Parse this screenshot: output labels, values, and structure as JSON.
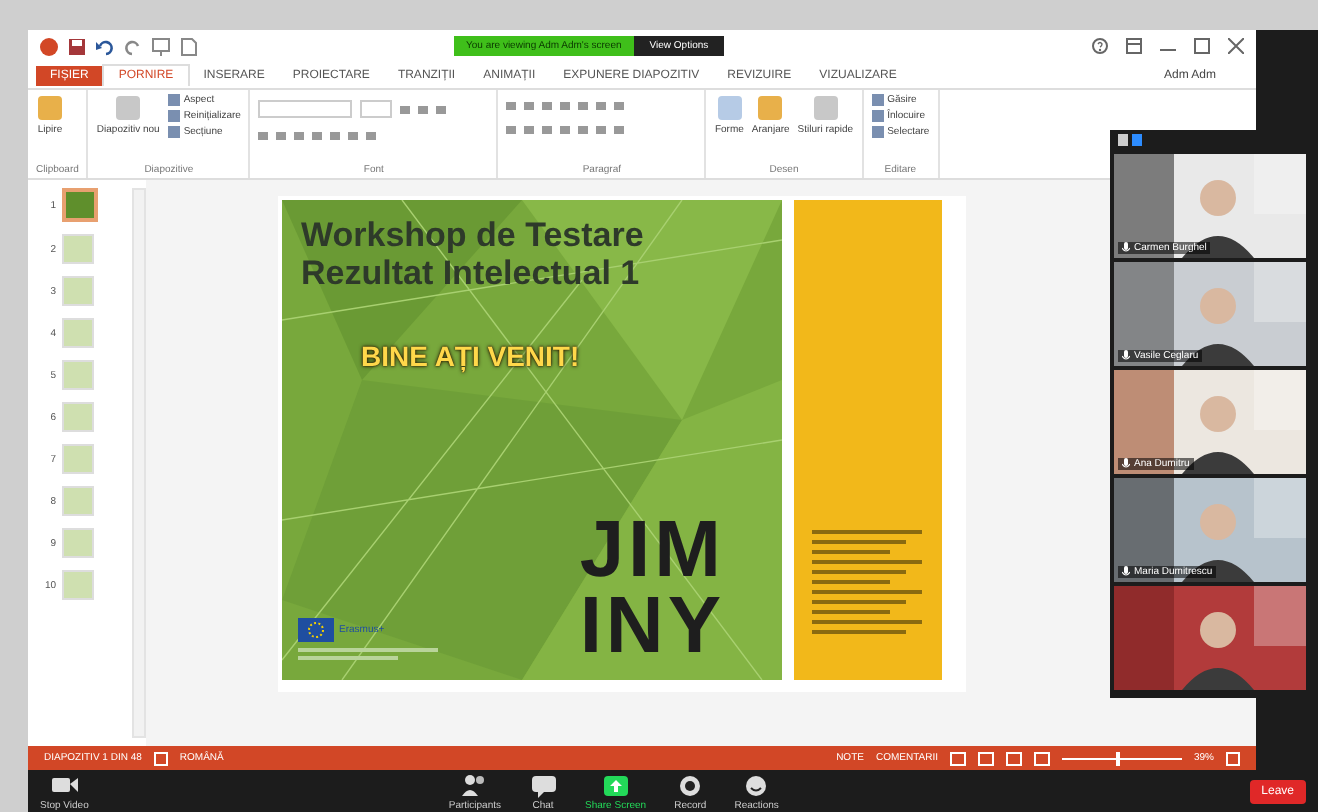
{
  "title_bar": {
    "banner": "You are viewing Adm Adm's screen",
    "view_options": "View Options",
    "account": "Adm Adm"
  },
  "ribbon_tabs": [
    {
      "label": "FIȘIER",
      "kind": "file",
      "selected": false
    },
    {
      "label": "PORNIRE",
      "kind": "tab",
      "selected": true
    },
    {
      "label": "INSERARE",
      "kind": "tab",
      "selected": false
    },
    {
      "label": "PROIECTARE",
      "kind": "tab",
      "selected": false
    },
    {
      "label": "TRANZIȚII",
      "kind": "tab",
      "selected": false
    },
    {
      "label": "ANIMAȚII",
      "kind": "tab",
      "selected": false
    },
    {
      "label": "EXPUNERE DIAPOZITIV",
      "kind": "tab",
      "selected": false
    },
    {
      "label": "REVIZUIRE",
      "kind": "tab",
      "selected": false
    },
    {
      "label": "VIZUALIZARE",
      "kind": "tab",
      "selected": false
    }
  ],
  "ribbon_groups": [
    {
      "name": "Clipboard",
      "commands": [
        {
          "label": "Lipire",
          "kind": "large"
        }
      ]
    },
    {
      "name": "Diapozitive",
      "commands": [
        {
          "label": "Diapozitiv nou",
          "kind": "large"
        },
        {
          "label": "Aspect",
          "kind": "small"
        },
        {
          "label": "Reinițializare",
          "kind": "small"
        },
        {
          "label": "Secțiune",
          "kind": "small"
        }
      ]
    },
    {
      "name": "Font",
      "commands": [
        {
          "kind": "tools"
        }
      ]
    },
    {
      "name": "Paragraf",
      "commands": [
        {
          "kind": "tools"
        }
      ]
    },
    {
      "name": "Desen",
      "commands": [
        {
          "label": "Forme",
          "kind": "large"
        },
        {
          "label": "Aranjare",
          "kind": "large"
        },
        {
          "label": "Stiluri rapide",
          "kind": "large"
        }
      ]
    },
    {
      "name": "Editare",
      "commands": [
        {
          "label": "Găsire",
          "kind": "small"
        },
        {
          "label": "Înlocuire",
          "kind": "small"
        },
        {
          "label": "Selectare",
          "kind": "small"
        }
      ]
    }
  ],
  "thumbnails": [
    {
      "number": "1",
      "selected": true
    },
    {
      "number": "2",
      "selected": false
    },
    {
      "number": "3",
      "selected": false
    },
    {
      "number": "4",
      "selected": false
    },
    {
      "number": "5",
      "selected": false
    },
    {
      "number": "6",
      "selected": false
    },
    {
      "number": "7",
      "selected": false
    },
    {
      "number": "8",
      "selected": false
    },
    {
      "number": "9",
      "selected": false
    },
    {
      "number": "10",
      "selected": false
    }
  ],
  "slide": {
    "title_lines": [
      "Workshop de Testare",
      "Rezultat Intelectual 1"
    ],
    "greeting": "BINE AȚI VENIT!",
    "logo_top": "JIM",
    "logo_bottom": "INY",
    "eu_label": "Erasmus+"
  },
  "status_bar": {
    "left": [
      "DIAPOZITIV 1 DIN 48",
      "ROMÂNĂ"
    ],
    "right": [
      "NOTE",
      "COMENTARII"
    ],
    "zoom": "39%",
    "level": 0.45
  },
  "participants": [
    {
      "kind": "camera",
      "name": "Carmen Burghel"
    },
    {
      "kind": "camera",
      "name": "Vasile Ceglaru"
    },
    {
      "kind": "camera",
      "name": "Ana Dumitru"
    },
    {
      "kind": "camera",
      "name": "Maria Dumitrescu"
    },
    {
      "kind": "camera"
    }
  ],
  "meeting_toolbar": {
    "left": [
      {
        "label": "Stop Video",
        "kind": "video",
        "active": false
      }
    ],
    "center": [
      {
        "label": "Participants",
        "kind": "people",
        "active": false
      },
      {
        "label": "Chat",
        "kind": "chat",
        "active": false
      },
      {
        "label": "Share Screen",
        "kind": "share",
        "active": true
      },
      {
        "label": "Record",
        "kind": "record",
        "active": false
      },
      {
        "label": "Reactions",
        "kind": "smile",
        "active": false
      }
    ],
    "leave": "Leave"
  }
}
